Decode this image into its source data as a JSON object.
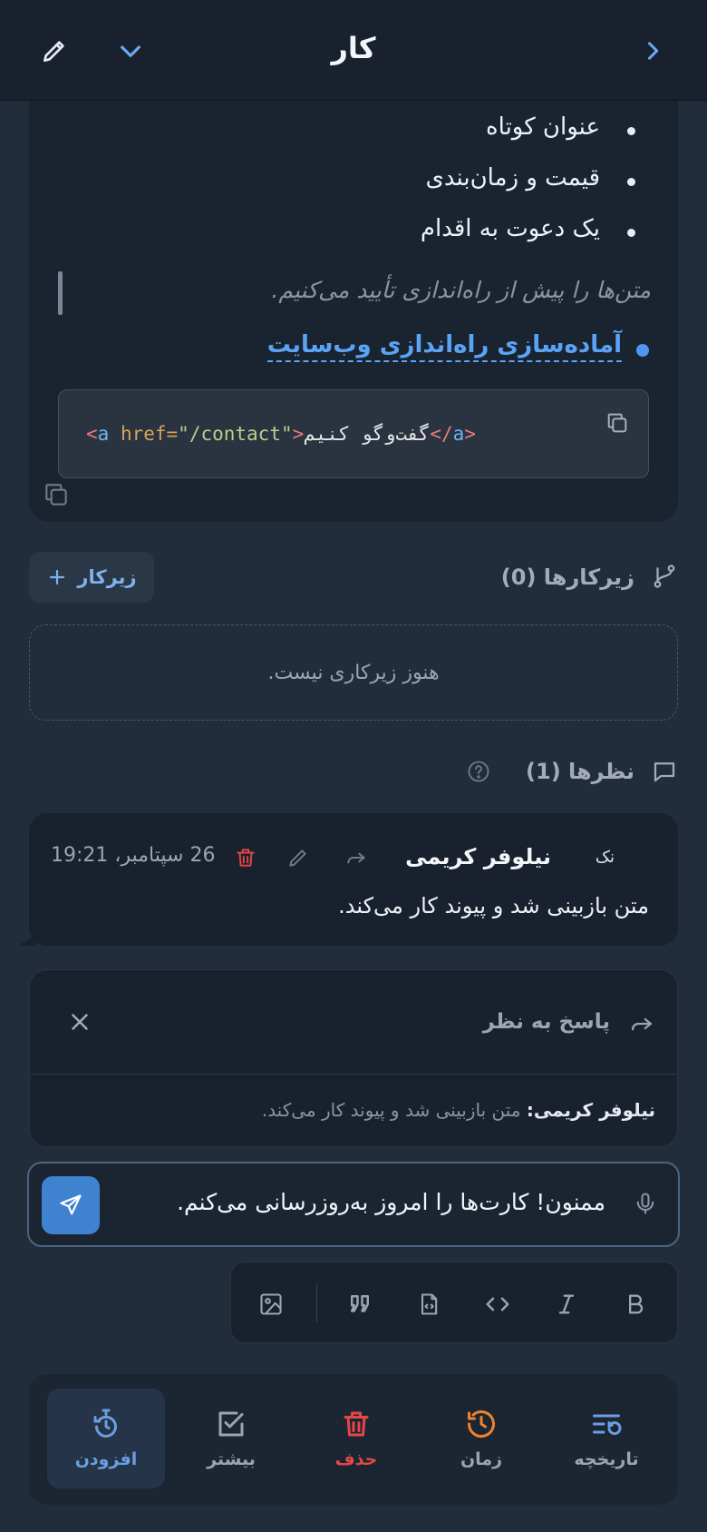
{
  "header": {
    "title": "کار"
  },
  "description": {
    "bullets": [
      "عنوان کوتاه",
      "قیمت و زمان‌بندی",
      "یک دعوت به اقدام"
    ],
    "quote": "متن‌ها را پیش از راه‌اندازی تأیید می‌کنیم.",
    "link": "آماده‌سازی راه‌اندازی وب‌سایت",
    "code": {
      "lt": "<",
      "tag": "a",
      "attr": " href=",
      "value": "\"/contact\"",
      "gt": ">",
      "text": "گفت‌وگو کنیم",
      "close_lt": "</",
      "close_tag": "a",
      "close_gt": ">"
    }
  },
  "subtasks": {
    "title": "زیرکارها (0)",
    "add_label": "زیرکار",
    "empty": "هنوز زیرکاری نیست."
  },
  "comments": {
    "title": "نظرها (1)",
    "items": [
      {
        "initials": "نک",
        "author": "نیلوفر کریمی",
        "time": "26 سپتامبر، 19:21",
        "body": "متن بازبینی شد و پیوند کار می‌کند."
      }
    ]
  },
  "reply": {
    "label": "پاسخ به نظر",
    "quote_author": "نیلوفر کریمی",
    "quote_sep": ":",
    "quote_text": "متن بازبینی شد و پیوند کار می‌کند."
  },
  "composer": {
    "value": "ممنون! کارت‌ها را امروز به‌روزرسانی می‌کنم."
  },
  "bottom_tabs": [
    {
      "label": "تاریخچه",
      "color": "#6a9fe0"
    },
    {
      "label": "زمان",
      "color": "#f0822e"
    },
    {
      "label": "حذف",
      "color": "#e54646"
    },
    {
      "label": "بیشتر",
      "color": "#9aa4b2"
    },
    {
      "label": "افزودن",
      "color": "#6a9fe0"
    }
  ],
  "colors": {
    "accent": "#5aa3f5",
    "danger": "#e54646",
    "background": "#222d3c",
    "card": "#18212d"
  }
}
